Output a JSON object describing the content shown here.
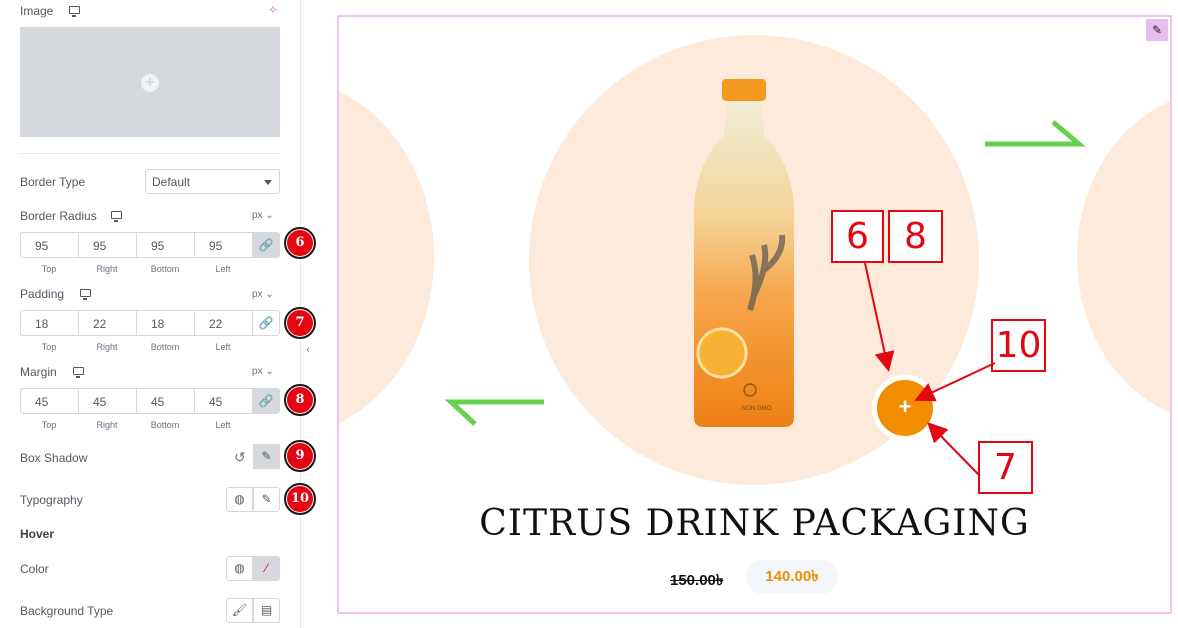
{
  "panel": {
    "image_label": "Image",
    "border_type": {
      "label": "Border Type",
      "value": "Default"
    },
    "border_radius": {
      "label": "Border Radius",
      "unit": "px",
      "values": [
        "95",
        "95",
        "95",
        "95"
      ]
    },
    "padding": {
      "label": "Padding",
      "unit": "px",
      "values": [
        "18",
        "22",
        "18",
        "22"
      ]
    },
    "margin": {
      "label": "Margin",
      "unit": "px",
      "values": [
        "45",
        "45",
        "45",
        "45"
      ]
    },
    "side_labels": [
      "Top",
      "Right",
      "Bottom",
      "Left"
    ],
    "box_shadow_label": "Box Shadow",
    "typography_label": "Typography",
    "hover_heading": "Hover",
    "color_label": "Color",
    "background_type_label": "Background Type",
    "badges": [
      "6",
      "7",
      "8",
      "9",
      "10"
    ]
  },
  "preview": {
    "title": "CITRUS DRINK PACKAGING",
    "old_price": "150.00৳",
    "new_price": "140.00৳",
    "add_button": "+",
    "bottle_text": {
      "non_gmo": "NON GMO"
    }
  },
  "annotations": [
    "6",
    "8",
    "10",
    "7"
  ],
  "colors": {
    "accent": "#f28c00",
    "badge": "#e30613",
    "arrow_green": "#66d14f",
    "circle_bg": "#fdeadb",
    "frame": "#f0c4f0"
  }
}
